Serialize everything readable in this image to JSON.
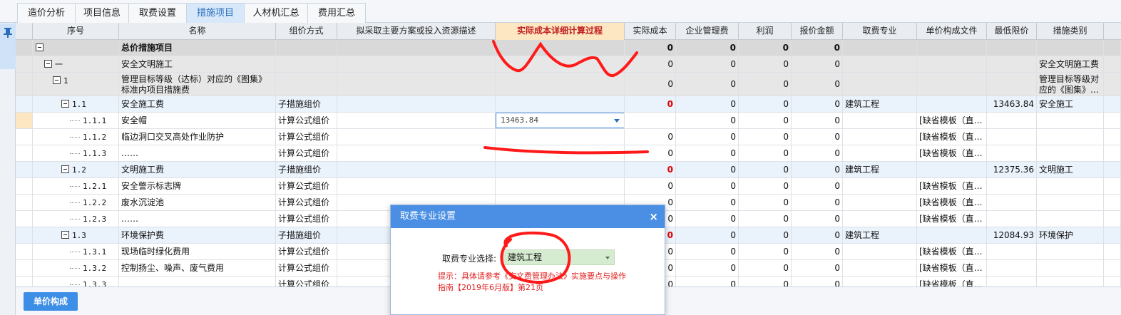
{
  "tabs": [
    "造价分析",
    "项目信息",
    "取费设置",
    "措施项目",
    "人材机汇总",
    "费用汇总"
  ],
  "active_tab": "措施项目",
  "columns": [
    "序号",
    "名称",
    "组价方式",
    "拟采取主要方案或投入资源描述",
    "实际成本详细计算过程",
    "实际成本",
    "企业管理费",
    "利润",
    "报价金额",
    "取费专业",
    "单价构成文件",
    "最低限价",
    "措施类别"
  ],
  "highlight_column": "实际成本详细计算过程",
  "rows": [
    {
      "seq": "",
      "name": "总价措施项目",
      "method": "",
      "cost": "0",
      "mgmt": "0",
      "profit": "0",
      "quote": "0",
      "major": "",
      "file": "",
      "min": "",
      "type": ""
    },
    {
      "seq": "一",
      "name": "安全文明施工",
      "method": "",
      "cost": "0",
      "mgmt": "0",
      "profit": "0",
      "quote": "0",
      "major": "",
      "file": "",
      "min": "",
      "type": "安全文明施工费"
    },
    {
      "seq": "1",
      "name": "管理目标等级（达标）对应的《图集》标准内项目措施费",
      "method": "",
      "cost": "0",
      "mgmt": "0",
      "profit": "0",
      "quote": "0",
      "major": "",
      "file": "",
      "min": "",
      "type": "管理目标等级对应的《图集》…"
    },
    {
      "seq": "1.1",
      "name": "安全施工费",
      "method": "子措施组价",
      "cost": "0",
      "mgmt": "0",
      "profit": "0",
      "quote": "0",
      "major": "建筑工程",
      "file": "",
      "min": "13463.84",
      "type": "安全施工"
    },
    {
      "seq": "1.1.1",
      "name": "安全帽",
      "method": "计算公式组价",
      "calc": "13463.84",
      "cost": "",
      "mgmt": "0",
      "profit": "0",
      "quote": "0",
      "major": "",
      "file": "[缺省模板（直…",
      "min": "",
      "type": ""
    },
    {
      "seq": "1.1.2",
      "name": "临边洞口交叉高处作业防护",
      "method": "计算公式组价",
      "cost": "0",
      "mgmt": "0",
      "profit": "0",
      "quote": "0",
      "major": "",
      "file": "[缺省模板（直…",
      "min": "",
      "type": ""
    },
    {
      "seq": "1.1.3",
      "name": "……",
      "method": "计算公式组价",
      "cost": "0",
      "mgmt": "0",
      "profit": "0",
      "quote": "0",
      "major": "",
      "file": "[缺省模板（直…",
      "min": "",
      "type": ""
    },
    {
      "seq": "1.2",
      "name": "文明施工费",
      "method": "子措施组价",
      "cost": "0",
      "mgmt": "0",
      "profit": "0",
      "quote": "0",
      "major": "建筑工程",
      "file": "",
      "min": "12375.36",
      "type": "文明施工"
    },
    {
      "seq": "1.2.1",
      "name": "安全警示标志牌",
      "method": "计算公式组价",
      "cost": "0",
      "mgmt": "0",
      "profit": "0",
      "quote": "0",
      "major": "",
      "file": "[缺省模板（直…",
      "min": "",
      "type": ""
    },
    {
      "seq": "1.2.2",
      "name": "废水沉淀池",
      "method": "计算公式组价",
      "cost": "0",
      "mgmt": "0",
      "profit": "0",
      "quote": "0",
      "major": "",
      "file": "[缺省模板（直…",
      "min": "",
      "type": ""
    },
    {
      "seq": "1.2.3",
      "name": "……",
      "method": "计算公式组价",
      "cost": "0",
      "mgmt": "0",
      "profit": "0",
      "quote": "0",
      "major": "",
      "file": "[缺省模板（直…",
      "min": "",
      "type": ""
    },
    {
      "seq": "1.3",
      "name": "环境保护费",
      "method": "子措施组价",
      "cost": "0",
      "mgmt": "0",
      "profit": "0",
      "quote": "0",
      "major": "建筑工程",
      "file": "",
      "min": "12084.93",
      "type": "环境保护"
    },
    {
      "seq": "1.3.1",
      "name": "现场临时绿化费用",
      "method": "计算公式组价",
      "cost": "0",
      "mgmt": "0",
      "profit": "0",
      "quote": "0",
      "major": "",
      "file": "[缺省模板（直…",
      "min": "",
      "type": ""
    },
    {
      "seq": "1.3.2",
      "name": "控制扬尘、噪声、废气费用",
      "method": "计算公式组价",
      "cost": "0",
      "mgmt": "0",
      "profit": "0",
      "quote": "0",
      "major": "",
      "file": "[缺省模板（直…",
      "min": "",
      "type": ""
    },
    {
      "seq": "1.3.3",
      "name": "",
      "method": "计算公式组价",
      "cost": "0",
      "mgmt": "0",
      "profit": "0",
      "quote": "0",
      "major": "",
      "file": "[缺省模板（直…",
      "min": "",
      "type": ""
    }
  ],
  "bottom_button": "单价构成",
  "dialog": {
    "title": "取费专业设置",
    "close": "×",
    "label": "取费专业选择:",
    "selected": "建筑工程",
    "hint": "提示：具体请参考《安文费管理办法》实施要点与操作指南【2019年6月版】第21页"
  },
  "colors": {
    "annotation": "#ff1a1a",
    "header_highlight": "#fde7c2",
    "dialog_title": "#4a8fe3",
    "tab_active": "#d7e8fa"
  }
}
